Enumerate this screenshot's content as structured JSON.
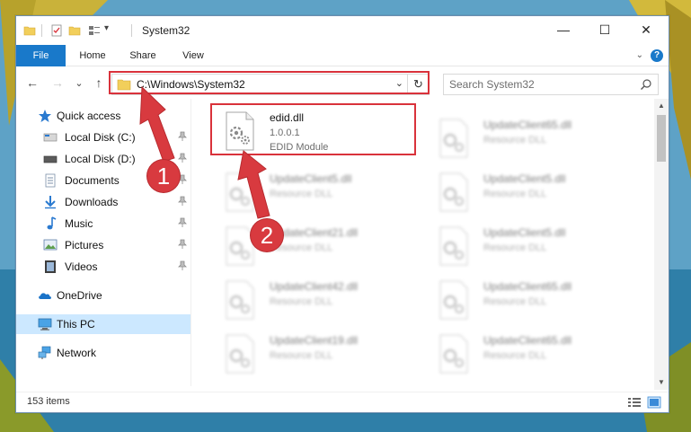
{
  "window": {
    "title": "System32",
    "controls": {
      "minimize": "—",
      "maximize": "☐",
      "close": "✕"
    }
  },
  "ribbon": {
    "tabs": [
      {
        "label": "File",
        "active": true
      },
      {
        "label": "Home"
      },
      {
        "label": "Share"
      },
      {
        "label": "View"
      }
    ],
    "help_label": "?"
  },
  "navigation": {
    "back": "←",
    "forward": "→",
    "recent": "⌄",
    "up": "↑"
  },
  "address": {
    "path": "C:\\Windows\\System32",
    "refresh": "↻"
  },
  "search": {
    "placeholder": "Search System32"
  },
  "nav_pane": {
    "items": [
      {
        "label": "Quick access",
        "icon": "star-icon"
      },
      {
        "label": "Local Disk (C:)",
        "icon": "drive-icon",
        "pinned": true
      },
      {
        "label": "Local Disk (D:)",
        "icon": "drive-icon",
        "pinned": true
      },
      {
        "label": "Documents",
        "icon": "documents-icon",
        "pinned": true
      },
      {
        "label": "Downloads",
        "icon": "downloads-icon",
        "pinned": true
      },
      {
        "label": "Music",
        "icon": "music-icon",
        "pinned": true
      },
      {
        "label": "Pictures",
        "icon": "pictures-icon",
        "pinned": true
      },
      {
        "label": "Videos",
        "icon": "videos-icon",
        "pinned": true
      },
      {
        "label": "OneDrive",
        "icon": "onedrive-icon"
      },
      {
        "label": "This PC",
        "icon": "computer-icon",
        "selected": true
      },
      {
        "label": "Network",
        "icon": "network-icon"
      }
    ]
  },
  "files": {
    "focused": {
      "name": "edid.dll",
      "version": "1.0.0.1",
      "description": "EDID Module"
    },
    "left": [
      {
        "name": "UpdateClient5.dll",
        "description": "Resource DLL"
      },
      {
        "name": "UpdateClient21.dll",
        "description": "Resource DLL"
      },
      {
        "name": "UpdateClient42.dll",
        "description": "Resource DLL"
      },
      {
        "name": "UpdateClient19.dll",
        "description": "Resource DLL"
      }
    ],
    "right": [
      {
        "name": "UpdateClient65.dll",
        "description": "Resource DLL"
      },
      {
        "name": "UpdateClient5.dll",
        "description": "Resource DLL"
      },
      {
        "name": "UpdateClient5.dll",
        "description": "Resource DLL"
      },
      {
        "name": "UpdateClient65.dll",
        "description": "Resource DLL"
      },
      {
        "name": "UpdateClient65.dll",
        "description": "Resource DLL"
      }
    ]
  },
  "status_bar": {
    "item_count": "153 items"
  },
  "annotations": {
    "step1": "1",
    "step2": "2"
  },
  "colors": {
    "accent": "#1979ca",
    "highlight": "#d9323b",
    "badge": "#d83a3f",
    "selected": "#cce8ff"
  }
}
